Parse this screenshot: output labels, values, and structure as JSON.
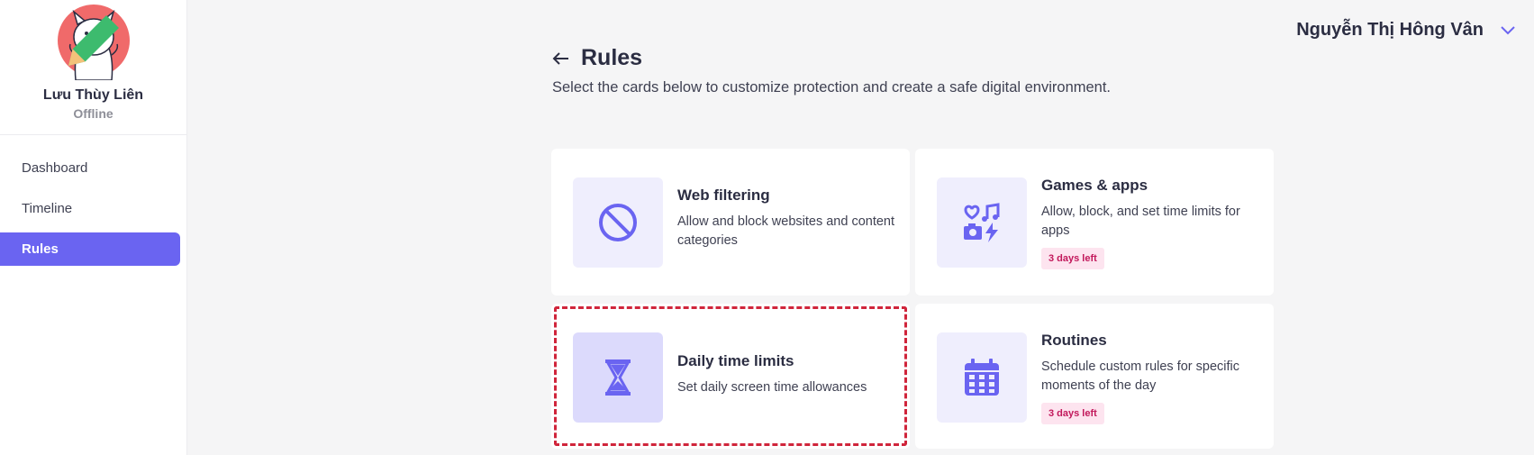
{
  "profile": {
    "name": "Lưu Thùy Liên",
    "status": "Offline"
  },
  "nav": {
    "items": [
      {
        "label": "Dashboard"
      },
      {
        "label": "Timeline"
      },
      {
        "label": "Rules"
      }
    ],
    "active": "Rules"
  },
  "header": {
    "user_name": "Nguyễn Thị Hông Vân"
  },
  "page": {
    "title": "Rules",
    "subtitle": "Select the cards below to customize protection and create a safe digital environment."
  },
  "cards": [
    {
      "title": "Web filtering",
      "description": "Allow and block websites and content categories",
      "icon": "block-icon"
    },
    {
      "title": "Games & apps",
      "description": "Allow, block, and set time limits for apps",
      "badge": "3 days left",
      "icon": "apps-icon"
    },
    {
      "title": "Daily time limits",
      "description": "Set daily screen time allowances",
      "icon": "hourglass-icon"
    },
    {
      "title": "Routines",
      "description": "Schedule custom rules for specific moments of the day",
      "badge": "3 days left",
      "icon": "calendar-icon"
    }
  ],
  "colors": {
    "accent": "#6a64f1",
    "badge_bg": "#fde4ef",
    "badge_text": "#c2185b",
    "avatar_bg": "#f06a6a"
  }
}
